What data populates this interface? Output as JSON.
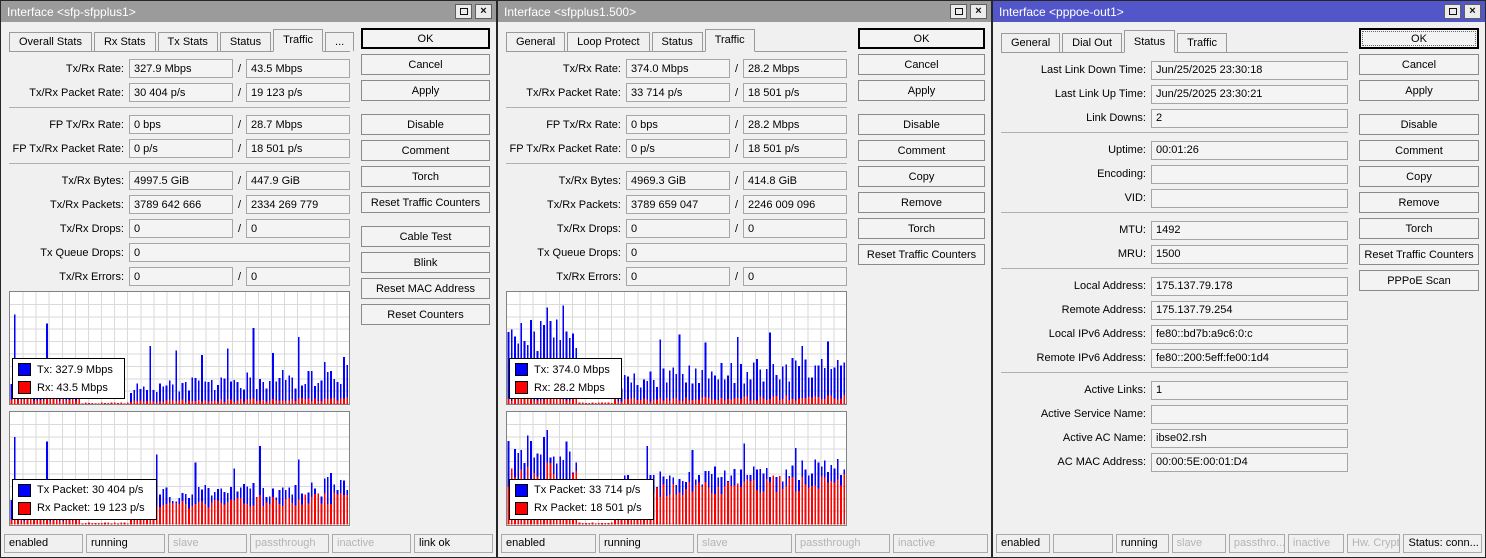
{
  "ui": {
    "close_glyph": "×",
    "slash": "/"
  },
  "colors": {
    "titlebar_active": "#5356c9",
    "titlebar_inactive": "#9b9b9b",
    "graph_tx": "#0000ff",
    "graph_rx": "#ff0000"
  },
  "w1": {
    "title": "Interface <sfp-sfpplus1>",
    "tabs": [
      "Overall Stats",
      "Rx Stats",
      "Tx Stats",
      "Status",
      "Traffic",
      "..."
    ],
    "active_tab_index": 4,
    "rows": [
      {
        "label": "Tx/Rx Rate:",
        "values": [
          "327.9 Mbps",
          "43.5 Mbps"
        ]
      },
      {
        "label": "Tx/Rx Packet Rate:",
        "values": [
          "30 404 p/s",
          "19 123 p/s"
        ]
      },
      {
        "sep": true
      },
      {
        "label": "FP Tx/Rx Rate:",
        "values": [
          "0 bps",
          "28.7 Mbps"
        ]
      },
      {
        "label": "FP Tx/Rx Packet Rate:",
        "values": [
          "0 p/s",
          "18 501 p/s"
        ]
      },
      {
        "sep": true
      },
      {
        "label": "Tx/Rx Bytes:",
        "values": [
          "4997.5 GiB",
          "447.9 GiB"
        ]
      },
      {
        "label": "Tx/Rx Packets:",
        "values": [
          "3789 642 666",
          "2334 269 779"
        ]
      },
      {
        "label": "Tx/Rx Drops:",
        "values": [
          "0",
          "0"
        ]
      },
      {
        "label": "Tx Queue Drops:",
        "values": [
          "0"
        ]
      },
      {
        "label": "Tx/Rx Errors:",
        "values": [
          "0",
          "0"
        ]
      }
    ],
    "buttons": [
      {
        "label": "OK",
        "default": true
      },
      {
        "label": "Cancel"
      },
      {
        "label": "Apply"
      },
      {
        "gap": true
      },
      {
        "label": "Disable"
      },
      {
        "label": "Comment"
      },
      {
        "label": "Torch"
      },
      {
        "label": "Reset Traffic Counters"
      },
      {
        "gap": true
      },
      {
        "label": "Cable Test"
      },
      {
        "label": "Blink"
      },
      {
        "label": "Reset MAC Address"
      },
      {
        "label": "Reset Counters"
      }
    ],
    "graphs": [
      {
        "seed": 11,
        "tx_color": "#0000ff",
        "rx_color": "#ff0000",
        "legend": [
          {
            "label": "Tx: 327.9 Mbps"
          },
          {
            "label": "Rx: 43.5 Mbps"
          }
        ],
        "segments": [
          {
            "n": 22,
            "tx": [
              6,
              30
            ],
            "rx": [
              3,
              6
            ],
            "spikes": {
              "1": 80,
              "11": 72,
              "13": 34,
              "17": 36
            }
          },
          {
            "n": 15,
            "tx": [
              0,
              1
            ],
            "rx": [
              1,
              2
            ]
          },
          {
            "n": 68,
            "tx": [
              16,
              36
            ],
            "rx": [
              3,
              7
            ],
            "ramp": [
              0.55,
              1
            ],
            "spikes": {
              "6": 52,
              "14": 48,
              "22": 44,
              "30": 50,
              "38": 68,
              "44": 46,
              "52": 60,
              "60": 38,
              "66": 42
            }
          }
        ]
      },
      {
        "seed": 22,
        "tx_color": "#0000ff",
        "rx_color": "#ff0000",
        "legend": [
          {
            "label": "Tx Packet: 30 404 p/s"
          },
          {
            "label": "Rx Packet: 19 123 p/s"
          }
        ],
        "segments": [
          {
            "n": 22,
            "tx": [
              8,
              30
            ],
            "rx": [
              3,
              10
            ],
            "spikes": {
              "1": 78,
              "11": 74,
              "13": 36
            }
          },
          {
            "n": 15,
            "tx": [
              0,
              1
            ],
            "rx": [
              1,
              2
            ]
          },
          {
            "n": 68,
            "tx": [
              26,
              44
            ],
            "rx": [
              18,
              30
            ],
            "ramp": [
              0.7,
              1
            ],
            "spikes": {
              "8": 62,
              "20": 55,
              "32": 50,
              "40": 70,
              "52": 58,
              "62": 46
            }
          }
        ]
      }
    ],
    "status": [
      {
        "label": "enabled",
        "active": true,
        "grow": 1
      },
      {
        "label": "running",
        "active": true,
        "grow": 1
      },
      {
        "label": "slave",
        "active": false,
        "grow": 1
      },
      {
        "label": "passthrough",
        "active": false,
        "grow": 1
      },
      {
        "label": "inactive",
        "active": false,
        "grow": 1
      },
      {
        "label": "link ok",
        "active": true,
        "grow": 1
      }
    ]
  },
  "w2": {
    "title": "Interface <sfpplus1.500>",
    "tabs": [
      "General",
      "Loop Protect",
      "Status",
      "Traffic"
    ],
    "active_tab_index": 3,
    "rows": [
      {
        "label": "Tx/Rx Rate:",
        "values": [
          "374.0 Mbps",
          "28.2 Mbps"
        ]
      },
      {
        "label": "Tx/Rx Packet Rate:",
        "values": [
          "33 714 p/s",
          "18 501 p/s"
        ]
      },
      {
        "sep": true
      },
      {
        "label": "FP Tx/Rx Rate:",
        "values": [
          "0 bps",
          "28.2 Mbps"
        ]
      },
      {
        "label": "FP Tx/Rx Packet Rate:",
        "values": [
          "0 p/s",
          "18 501 p/s"
        ]
      },
      {
        "sep": true
      },
      {
        "label": "Tx/Rx Bytes:",
        "values": [
          "4969.3 GiB",
          "414.8 GiB"
        ]
      },
      {
        "label": "Tx/Rx Packets:",
        "values": [
          "3789 659 047",
          "2246 009 096"
        ]
      },
      {
        "label": "Tx/Rx Drops:",
        "values": [
          "0",
          "0"
        ]
      },
      {
        "label": "Tx Queue Drops:",
        "values": [
          "0"
        ]
      },
      {
        "label": "Tx/Rx Errors:",
        "values": [
          "0",
          "0"
        ]
      }
    ],
    "buttons": [
      {
        "label": "OK",
        "default": true
      },
      {
        "label": "Cancel"
      },
      {
        "label": "Apply"
      },
      {
        "gap": true
      },
      {
        "label": "Disable"
      },
      {
        "label": "Comment"
      },
      {
        "label": "Copy"
      },
      {
        "label": "Remove"
      },
      {
        "label": "Torch"
      },
      {
        "label": "Reset Traffic Counters"
      }
    ],
    "graphs": [
      {
        "seed": 33,
        "tx_color": "#0000ff",
        "rx_color": "#ff0000",
        "legend": [
          {
            "label": "Tx: 374.0 Mbps"
          },
          {
            "label": "Rx: 28.2 Mbps"
          }
        ],
        "segments": [
          {
            "n": 22,
            "tx": [
              45,
              80
            ],
            "rx": [
              3,
              6
            ],
            "spikes": {
              "12": 86,
              "17": 88
            }
          },
          {
            "n": 11,
            "tx": [
              0,
              1
            ],
            "rx": [
              1,
              2
            ]
          },
          {
            "n": 72,
            "tx": [
              22,
              48
            ],
            "rx": [
              4,
              9
            ],
            "ramp": [
              0.6,
              1
            ],
            "spikes": {
              "14": 58,
              "20": 62,
              "28": 55,
              "38": 60,
              "48": 64,
              "58": 52,
              "66": 56
            }
          }
        ]
      },
      {
        "seed": 44,
        "tx_color": "#0000ff",
        "rx_color": "#ff0000",
        "legend": [
          {
            "label": "Tx Packet: 33 714 p/s"
          },
          {
            "label": "Rx Packet: 18 501 p/s"
          }
        ],
        "segments": [
          {
            "n": 22,
            "tx": [
              45,
              80
            ],
            "rx": [
              30,
              55
            ],
            "spikes": {
              "12": 84
            }
          },
          {
            "n": 11,
            "tx": [
              0,
              1
            ],
            "rx": [
              1,
              2
            ]
          },
          {
            "n": 72,
            "tx": [
              40,
              60
            ],
            "rx": [
              30,
              48
            ],
            "ramp": [
              0.75,
              1
            ],
            "spikes": {
              "10": 70,
              "24": 66,
              "40": 72,
              "56": 68
            }
          }
        ]
      }
    ],
    "status": [
      {
        "label": "enabled",
        "active": true,
        "grow": 1
      },
      {
        "label": "running",
        "active": true,
        "grow": 1
      },
      {
        "label": "slave",
        "active": false,
        "grow": 1
      },
      {
        "label": "passthrough",
        "active": false,
        "grow": 1
      },
      {
        "label": "inactive",
        "active": false,
        "grow": 1
      }
    ]
  },
  "w3": {
    "title": "Interface <pppoe-out1>",
    "tabs": [
      "General",
      "Dial Out",
      "Status",
      "Traffic"
    ],
    "active_tab_index": 2,
    "rows": [
      {
        "label": "Last Link Down Time:",
        "values": [
          "Jun/25/2025 23:30:18"
        ]
      },
      {
        "label": "Last Link Up Time:",
        "values": [
          "Jun/25/2025 23:30:21"
        ]
      },
      {
        "label": "Link Downs:",
        "values": [
          "2"
        ]
      },
      {
        "sep": true
      },
      {
        "label": "Uptime:",
        "values": [
          "00:01:26"
        ]
      },
      {
        "label": "Encoding:",
        "values": [
          ""
        ]
      },
      {
        "label": "VID:",
        "values": [
          ""
        ]
      },
      {
        "sep": true
      },
      {
        "label": "MTU:",
        "values": [
          "1492"
        ]
      },
      {
        "label": "MRU:",
        "values": [
          "1500"
        ]
      },
      {
        "sep": true
      },
      {
        "label": "Local Address:",
        "values": [
          "175.137.79.178"
        ]
      },
      {
        "label": "Remote Address:",
        "values": [
          "175.137.79.254"
        ]
      },
      {
        "label": "Local IPv6 Address:",
        "values": [
          "fe80::bd7b:a9c6:0:c"
        ]
      },
      {
        "label": "Remote IPv6 Address:",
        "values": [
          "fe80::200:5eff:fe00:1d4"
        ]
      },
      {
        "sep": true
      },
      {
        "label": "Active Links:",
        "values": [
          "1"
        ]
      },
      {
        "label": "Active Service Name:",
        "values": [
          ""
        ]
      },
      {
        "label": "Active AC Name:",
        "values": [
          "ibse02.rsh"
        ]
      },
      {
        "label": "AC MAC Address:",
        "values": [
          "00:00:5E:00:01:D4"
        ]
      }
    ],
    "buttons": [
      {
        "label": "OK",
        "default": true,
        "focus": true
      },
      {
        "label": "Cancel"
      },
      {
        "label": "Apply"
      },
      {
        "gap": true
      },
      {
        "label": "Disable"
      },
      {
        "label": "Comment"
      },
      {
        "label": "Copy"
      },
      {
        "label": "Remove"
      },
      {
        "label": "Torch"
      },
      {
        "label": "Reset Traffic Counters"
      },
      {
        "label": "PPPoE Scan"
      }
    ],
    "graphs": [],
    "status": [
      {
        "label": "enabled",
        "active": true,
        "grow": 56
      },
      {
        "label": "",
        "active": true,
        "grow": 62
      },
      {
        "label": "running",
        "active": true,
        "grow": 54
      },
      {
        "label": "slave",
        "active": false,
        "grow": 56
      },
      {
        "label": "passthro...",
        "active": false,
        "grow": 58
      },
      {
        "label": "inactive",
        "active": false,
        "grow": 58
      },
      {
        "label": "Hw. Crypto",
        "active": false,
        "grow": 55
      },
      {
        "label": "Status: conn...",
        "active": true,
        "grow": 84
      }
    ]
  }
}
